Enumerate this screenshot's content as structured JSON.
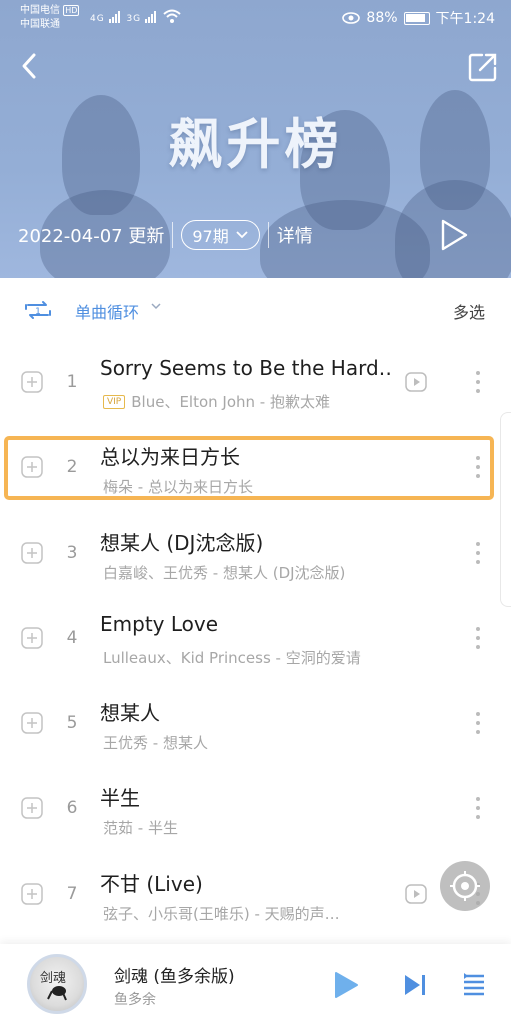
{
  "status": {
    "carrier1": "中国电信",
    "carrier2": "中国联通",
    "hd": "HD",
    "net1": "4G",
    "net2": "3G",
    "battery": "88%",
    "time": "下午1:24"
  },
  "header": {
    "chart_title": "飙升榜",
    "update_date": "2022-04-07 更新",
    "issue": "97期",
    "details": "详情",
    "bg_color": "#94aed6"
  },
  "toolbar": {
    "mode_label": "单曲循环",
    "multi_select": "多选",
    "accent": "#4f8fe0"
  },
  "songs": [
    {
      "rank": "1",
      "title": "Sorry Seems to Be the Hard…",
      "vip": "VIP",
      "sub": "Blue、Elton John - 抱歉太难",
      "has_mv": true
    },
    {
      "rank": "2",
      "title": "总以为来日方长",
      "sub": "梅朵 - 总以为来日方长",
      "has_mv": false
    },
    {
      "rank": "3",
      "title": "想某人 (DJ沈念版)",
      "sub": "白嘉峻、王优秀 - 想某人 (DJ沈念版)",
      "has_mv": false
    },
    {
      "rank": "4",
      "title": "Empty Love",
      "sub": "Lulleaux、Kid Princess - 空洞的爱请",
      "has_mv": false
    },
    {
      "rank": "5",
      "title": "想某人",
      "sub": "王优秀 - 想某人",
      "has_mv": false
    },
    {
      "rank": "6",
      "title": "半生",
      "sub": "范茹 - 半生",
      "has_mv": false
    },
    {
      "rank": "7",
      "title": "不甘 (Live)",
      "sub": "弦子、小乐哥(王唯乐) - 天赐的声…",
      "has_mv": true
    }
  ],
  "player": {
    "title": "剑魂 (鱼多余版)",
    "artist": "鱼多余",
    "cover_text": "剑魂"
  },
  "highlight_color": "#f6b554"
}
